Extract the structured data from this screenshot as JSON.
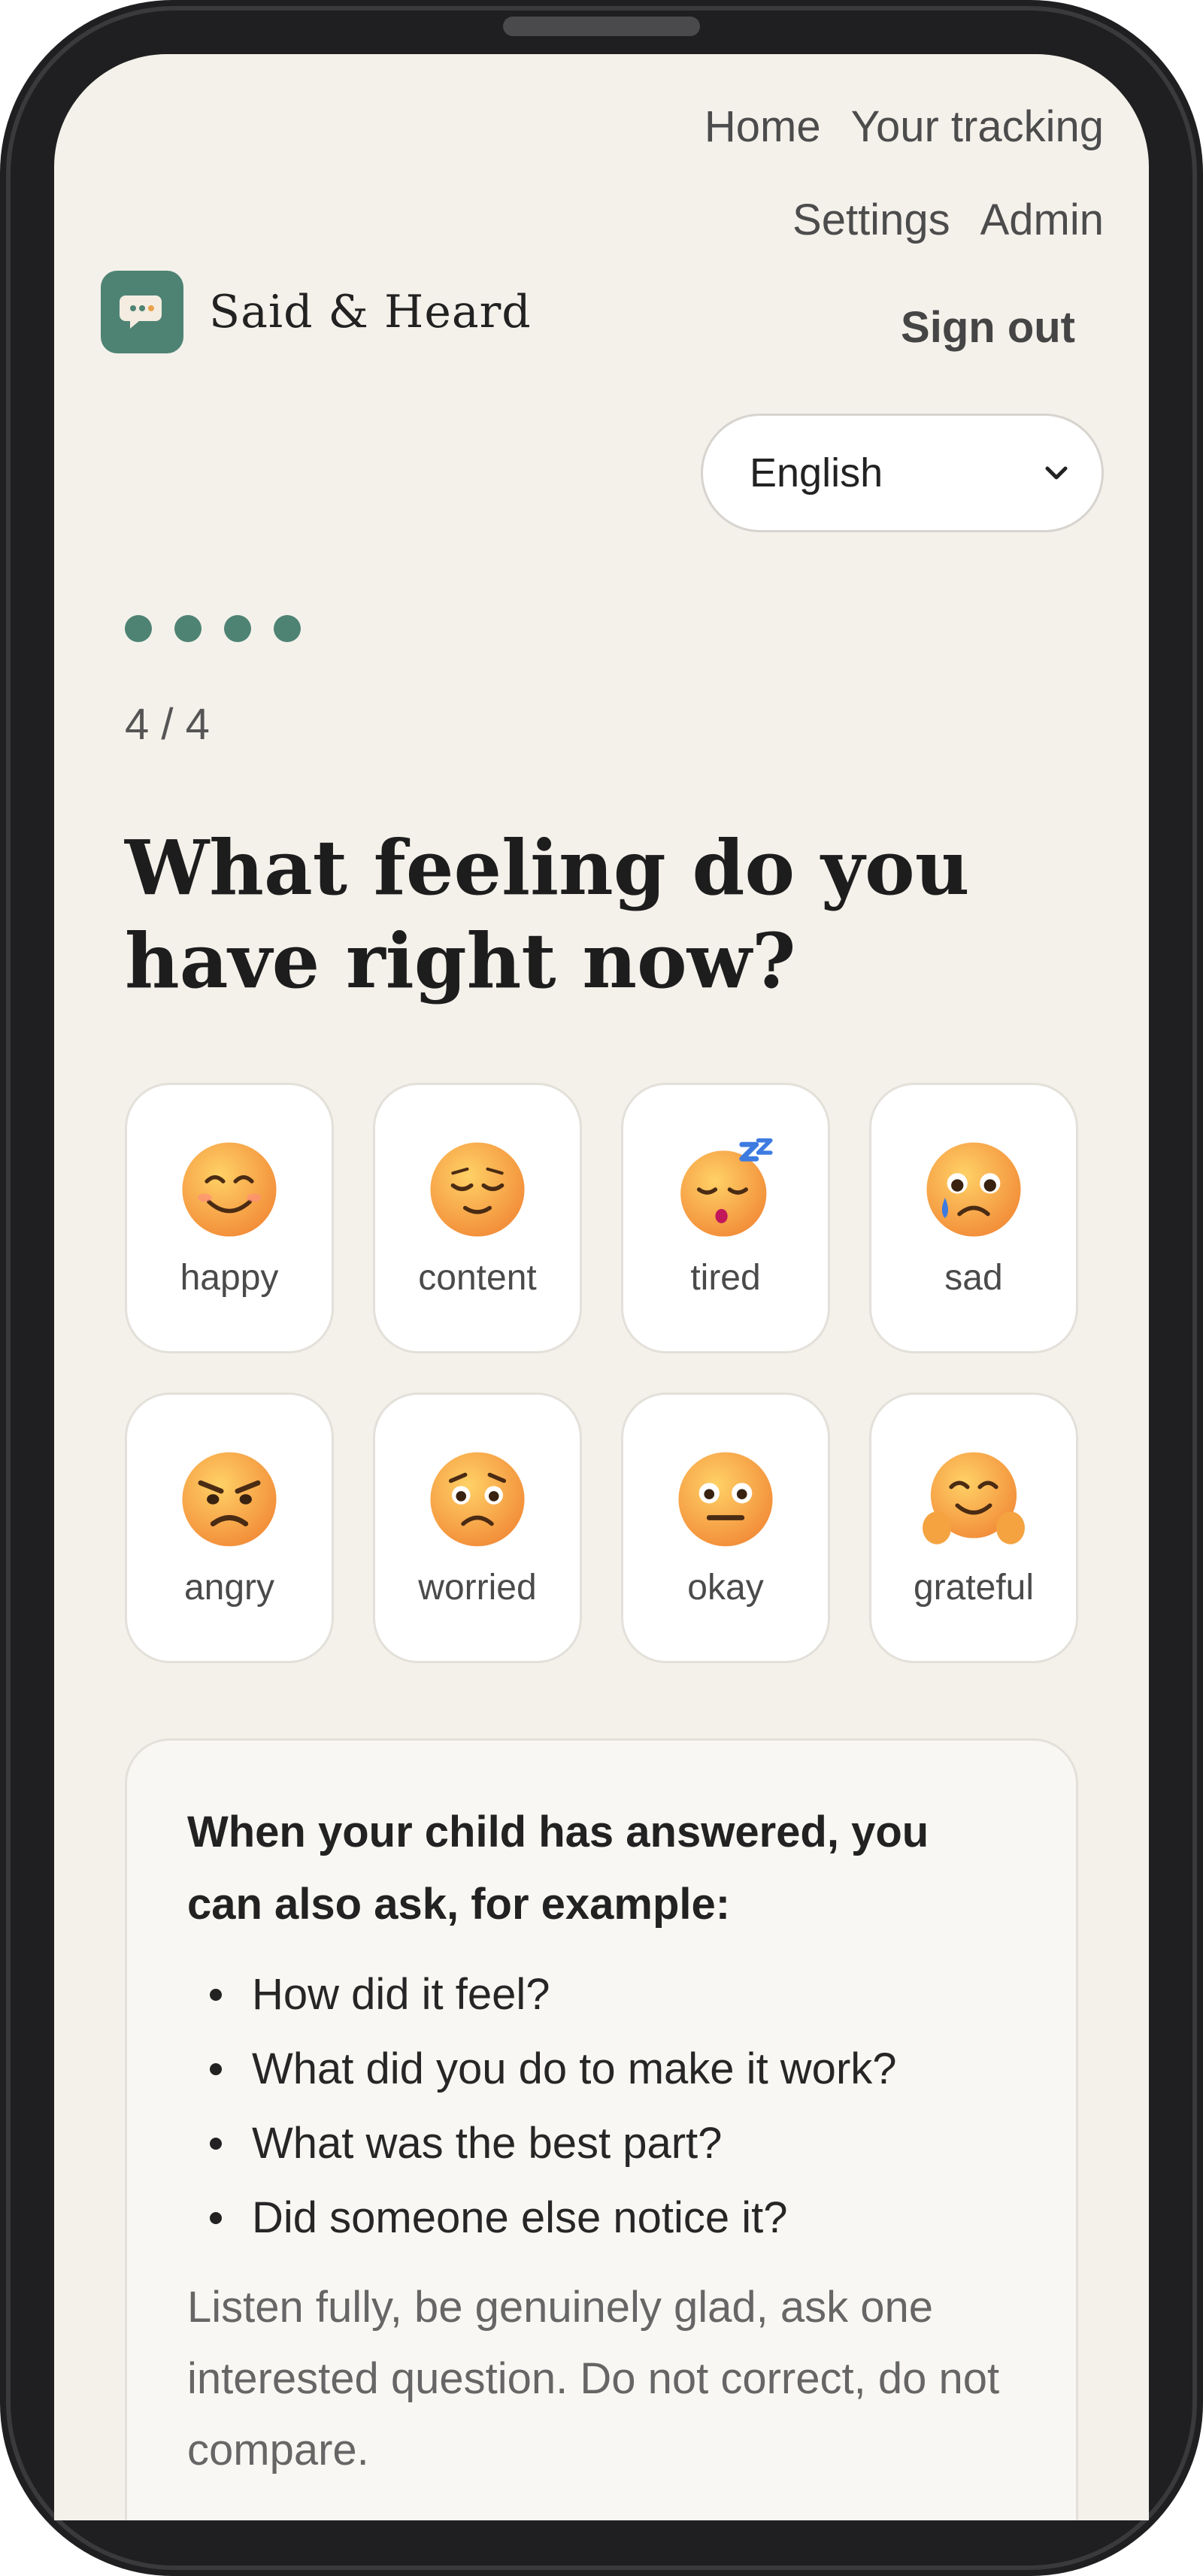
{
  "nav": {
    "home": "Home",
    "tracking": "Your tracking",
    "settings": "Settings",
    "admin": "Admin",
    "signout": "Sign out"
  },
  "brand": {
    "name": "Said & Heard",
    "icon": "speech-bubble-icon",
    "color": "#4e8374"
  },
  "language": {
    "selected": "English"
  },
  "progress": {
    "current": 4,
    "total": 4,
    "label": "4 / 4"
  },
  "question": "What feeling do you have right now?",
  "emotions": [
    {
      "label": "happy",
      "icon": "smiling-face-icon"
    },
    {
      "label": "content",
      "icon": "relieved-face-icon"
    },
    {
      "label": "tired",
      "icon": "sleeping-face-icon"
    },
    {
      "label": "sad",
      "icon": "crying-face-icon"
    },
    {
      "label": "angry",
      "icon": "angry-face-icon"
    },
    {
      "label": "worried",
      "icon": "worried-face-icon"
    },
    {
      "label": "okay",
      "icon": "neutral-face-icon"
    },
    {
      "label": "grateful",
      "icon": "hugging-face-icon"
    }
  ],
  "tip": {
    "heading": "When your child has answered, you can also ask, for example:",
    "questions": [
      "How did it feel?",
      "What did you do to make it work?",
      "What was the best part?",
      "Did someone else notice it?"
    ],
    "note": "Listen fully, be genuinely glad, ask one interested question. Do not correct, do not compare."
  },
  "colors": {
    "accent": "#4e8374",
    "background": "#f4f1eb",
    "card": "#ffffff"
  }
}
